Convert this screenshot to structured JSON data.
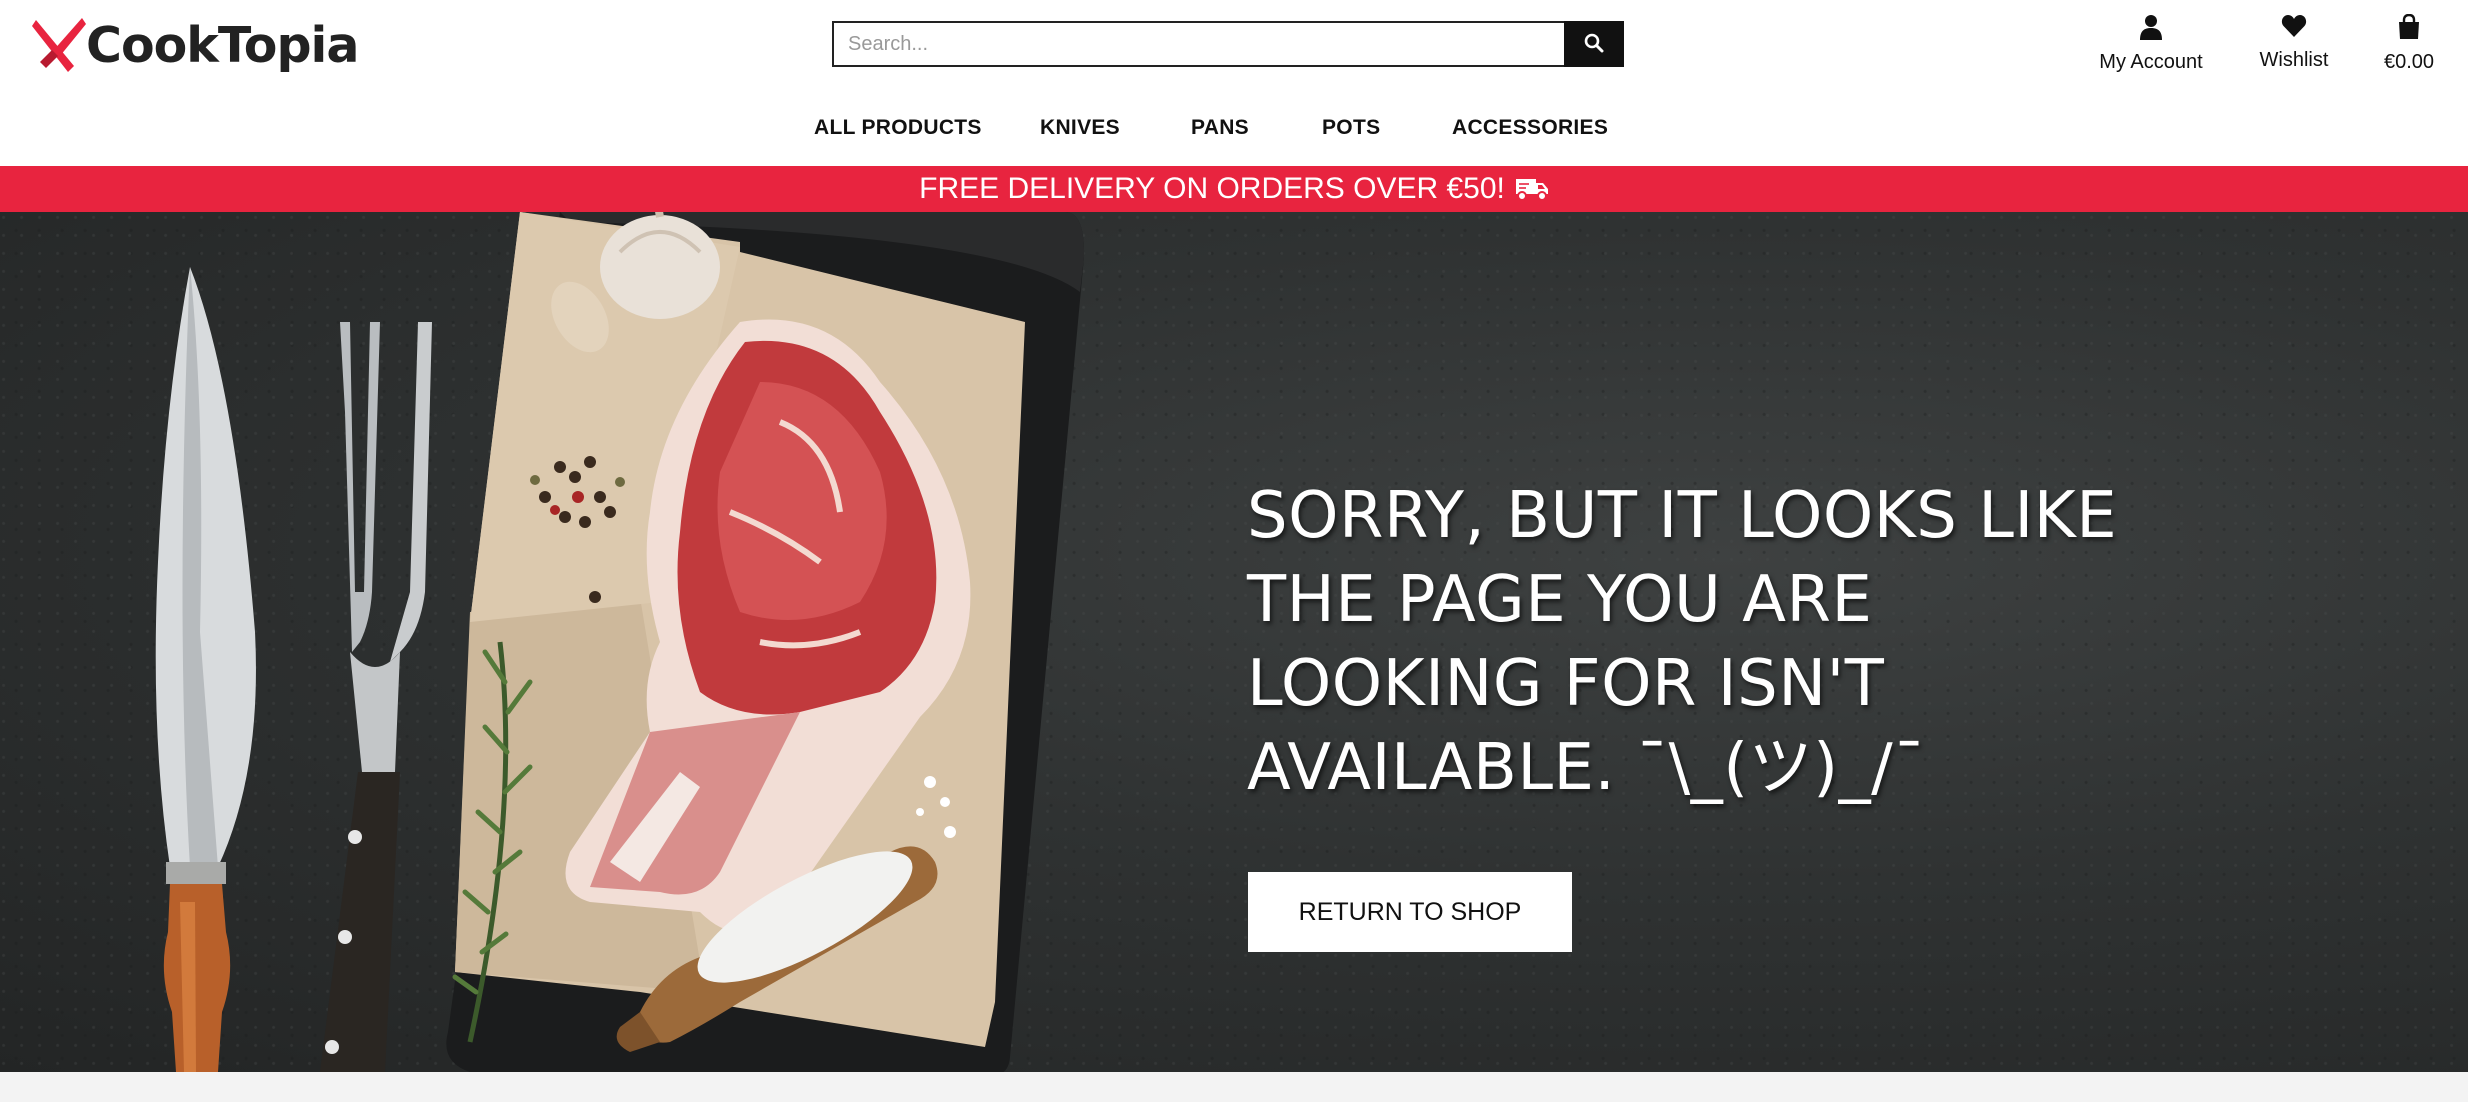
{
  "brand": {
    "name": "CookTopia",
    "accent_color": "#e8243f"
  },
  "search": {
    "placeholder": "Search...",
    "value": "",
    "icon": "search-icon"
  },
  "header_links": {
    "account": {
      "label": "My Account",
      "icon": "user-icon"
    },
    "wishlist": {
      "label": "Wishlist",
      "icon": "heart-icon"
    },
    "cart": {
      "label": "€0.00",
      "icon": "shopping-bag-icon"
    }
  },
  "nav": {
    "items": [
      {
        "label": "ALL PRODUCTS"
      },
      {
        "label": "KNIVES"
      },
      {
        "label": "PANS"
      },
      {
        "label": "POTS"
      },
      {
        "label": "ACCESSORIES"
      }
    ]
  },
  "promo": {
    "text": "FREE DELIVERY ON ORDERS OVER €50!",
    "icon": "truck-icon"
  },
  "hero": {
    "title": "SORRY, BUT IT LOOKS LIKE THE PAGE YOU ARE LOOKING FOR ISN'T AVAILABLE. ¯\\_(ツ)_/¯",
    "button_label": "RETURN TO SHOP",
    "image": "knife-fork-raw-steak-cutting-board"
  }
}
